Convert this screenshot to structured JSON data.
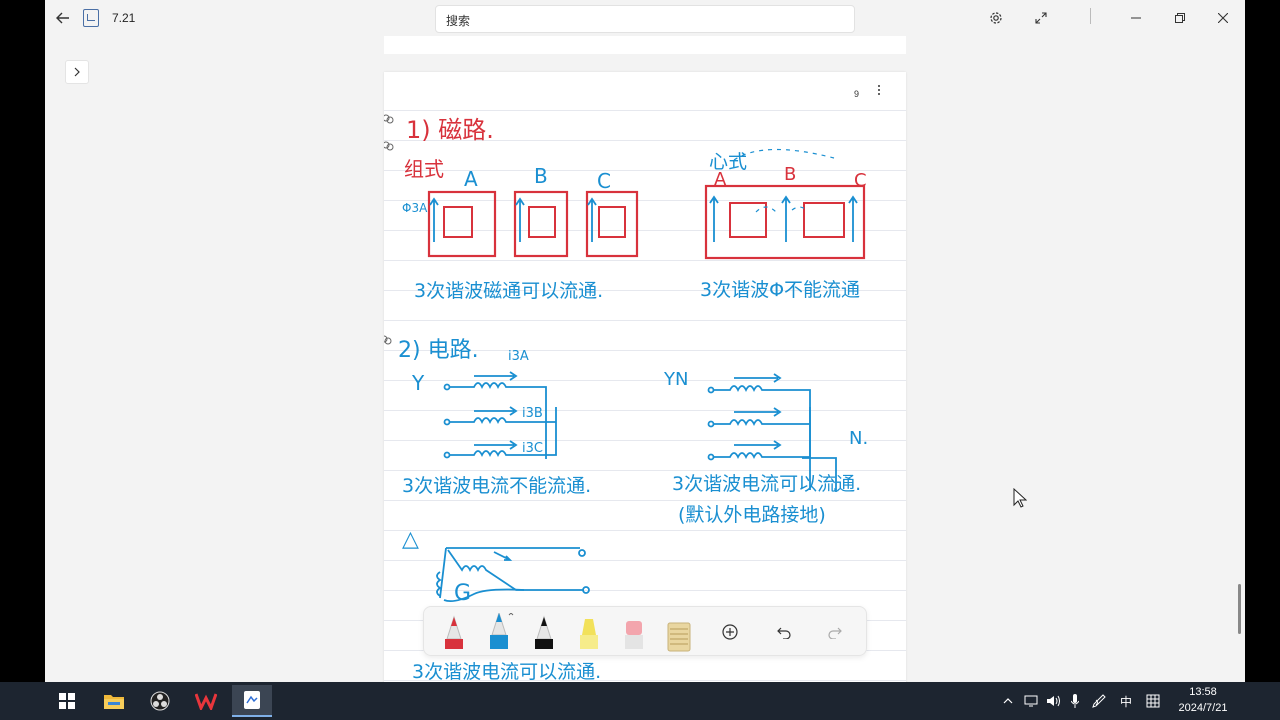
{
  "window": {
    "title": "7.21",
    "search_placeholder": "搜索"
  },
  "page": {
    "number": "9"
  },
  "notes": {
    "s1_heading": "1) 磁路.",
    "s1_left_label": "组式",
    "s1_right_label": "心式",
    "phase_a": "A",
    "phase_b": "B",
    "phase_c": "C",
    "flux_label": "Φ3A",
    "s1_left_caption": "3次谐波磁通可以流通.",
    "s1_right_caption": "3次谐波Φ不能流通",
    "s2_heading": "2) 电路.",
    "i3a": "i3A",
    "i3b": "i3B",
    "i3c": "i3C",
    "y_label": "Y",
    "yn_label": "YN",
    "n_label": "N.",
    "s2_left_caption": "3次谐波电流不能流通.",
    "s2_right_caption": "3次谐波电流可以流通.",
    "s2_right_note": "(默认外电路接地)",
    "delta_label": "△",
    "s3_caption": "3次谐波电流可以流通."
  },
  "toolbar": {
    "tools": [
      "red-pen",
      "blue-pen",
      "black-pen",
      "yellow-highlighter",
      "eraser",
      "ruler",
      "add",
      "undo",
      "redo"
    ]
  },
  "taskbar": {
    "ime": "中",
    "time": "13:58",
    "date": "2024/7/21"
  },
  "colors": {
    "red_ink": "#d8323c",
    "blue_ink": "#1a8fd1",
    "taskbar": "#1d2530"
  }
}
